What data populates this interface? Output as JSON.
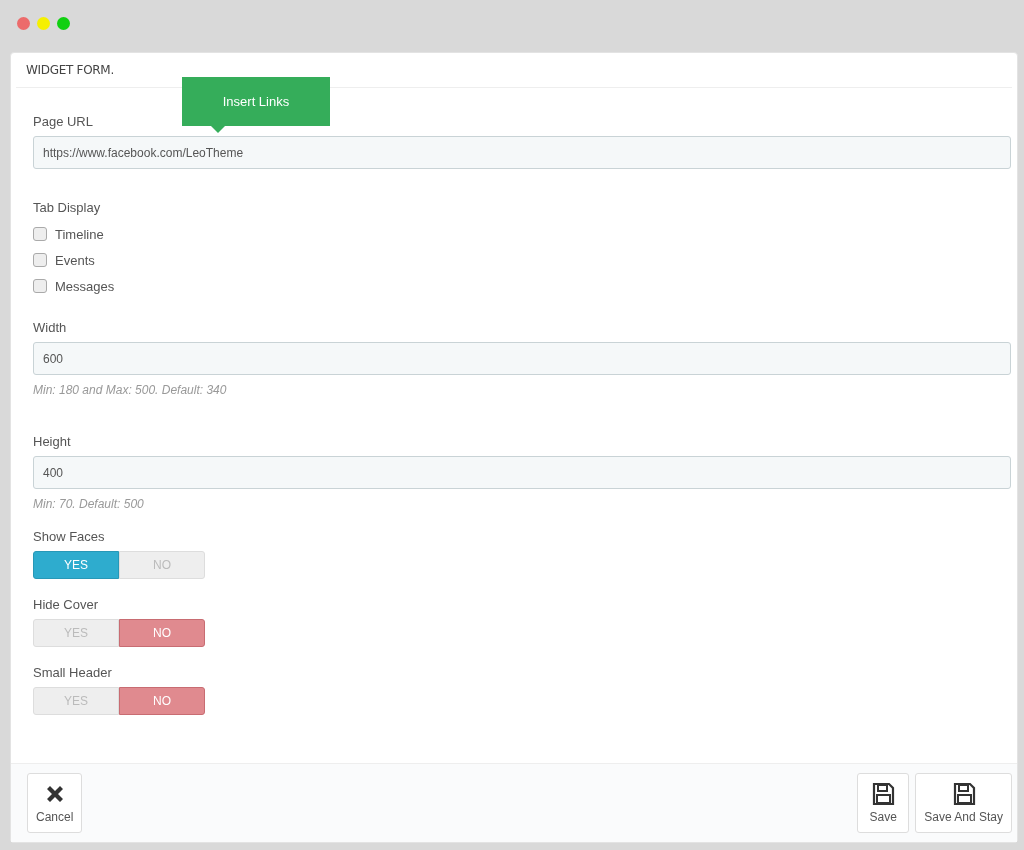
{
  "panel": {
    "title": "WIDGET FORM."
  },
  "tooltip": {
    "text": "Insert Links"
  },
  "page_url": {
    "label": "Page URL",
    "value": "https://www.facebook.com/LeoTheme"
  },
  "tab_display": {
    "label": "Tab Display",
    "options": [
      {
        "label": "Timeline",
        "checked": false
      },
      {
        "label": "Events",
        "checked": false
      },
      {
        "label": "Messages",
        "checked": false
      }
    ]
  },
  "width": {
    "label": "Width",
    "value": "600",
    "help": "Min: 180 and Max: 500. Default: 340"
  },
  "height": {
    "label": "Height",
    "value": "400",
    "help": "Min: 70. Default: 500"
  },
  "switches": [
    {
      "label": "Show Faces",
      "options": [
        {
          "label": "YES",
          "selected": true
        },
        {
          "label": "NO",
          "selected": false
        }
      ]
    },
    {
      "label": "Hide Cover",
      "options": [
        {
          "label": "YES",
          "selected": false
        },
        {
          "label": "NO",
          "selected": true
        }
      ]
    },
    {
      "label": "Small Header",
      "options": [
        {
          "label": "YES",
          "selected": false
        },
        {
          "label": "NO",
          "selected": true
        }
      ]
    }
  ],
  "footer": {
    "cancel": "Cancel",
    "buttons": [
      "Save",
      "Save And Stay"
    ]
  }
}
